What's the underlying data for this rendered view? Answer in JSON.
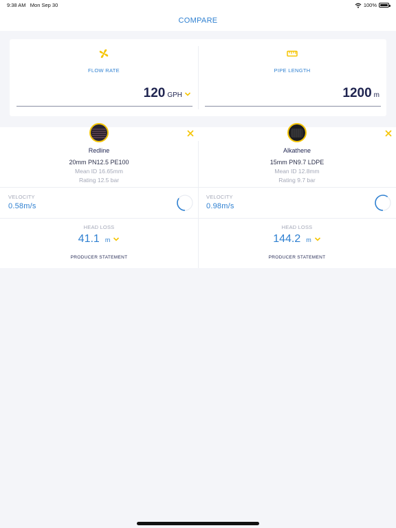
{
  "status": {
    "time": "9:38 AM",
    "date": "Mon Sep 30",
    "battery": "100%"
  },
  "nav": {
    "title": "COMPARE"
  },
  "inputs": {
    "flow": {
      "label": "FLOW RATE",
      "value": "120",
      "unit": "GPH",
      "icon": "fan-icon"
    },
    "length": {
      "label": "PIPE LENGTH",
      "value": "1200",
      "unit": "m",
      "icon": "ruler-icon"
    }
  },
  "pipes": [
    {
      "name": "Redline",
      "spec": "20mm PN12.5 PE100",
      "mean_id": "Mean ID 16.65mm",
      "rating": "Rating 12.5 bar",
      "velocity_label": "VELOCITY",
      "velocity": "0.58m/s",
      "velocity_fraction": 0.35,
      "headloss_label": "HEAD LOSS",
      "headloss": "41.1",
      "headloss_unit": "m",
      "producer": "PRODUCER STATEMENT"
    },
    {
      "name": "Alkathene",
      "spec": "15mm PN9.7 LDPE",
      "mean_id": "Mean ID 12.8mm",
      "rating": "Rating 9.7 bar",
      "velocity_label": "VELOCITY",
      "velocity": "0.98m/s",
      "velocity_fraction": 0.6,
      "headloss_label": "HEAD LOSS",
      "headloss": "144.2",
      "headloss_unit": "m",
      "producer": "PRODUCER STATEMENT"
    }
  ],
  "colors": {
    "accent": "#2f80d1",
    "highlight": "#f5c400",
    "text_dark": "#1f2450",
    "muted": "#a4a8b8"
  }
}
